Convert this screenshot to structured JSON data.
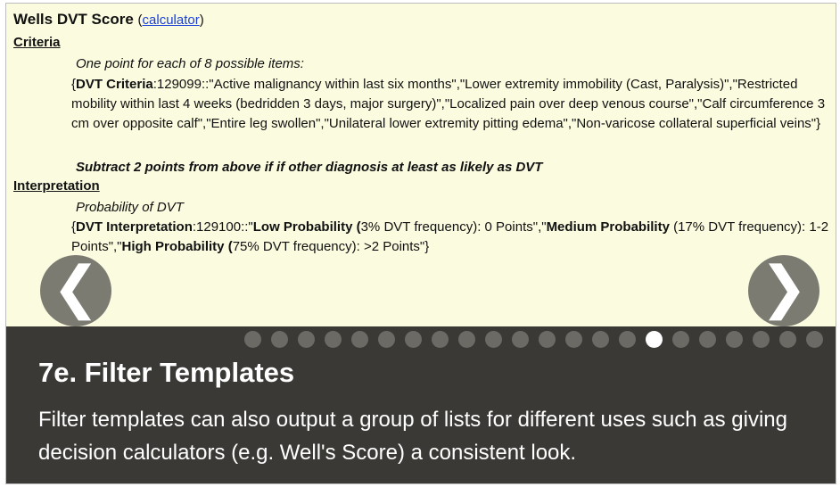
{
  "doc": {
    "title": "Wells DVT Score",
    "calculator_link_open": "(",
    "calculator_link": "calculator",
    "calculator_link_close": ")",
    "criteria_heading": "Criteria",
    "criteria_intro": "One point for each of 8 possible items:",
    "criteria_list": [
      {
        "text": "{",
        "bold": false
      },
      {
        "text": "DVT Criteria",
        "bold": true
      },
      {
        "text": ":129099::\"Active malignancy within last six months\",\"Lower extremity immobility (Cast, Paralysis)\",\"Restricted mobility within last 4 weeks (bedridden 3 days, major surgery)\",\"Localized pain over deep venous course\",\"Calf circumference 3 cm over opposite calf\",\"Entire leg swollen\",\"Unilateral lower extremity pitting edema\",\"Non-varicose collateral superficial veins\"}",
        "bold": false
      }
    ],
    "subtract_note": "Subtract 2 points from above if if other diagnosis at least as likely as DVT",
    "interpretation_heading": "Interpretation",
    "interpretation_intro": "Probability of DVT",
    "interpretation_list": [
      {
        "text": "{",
        "bold": false
      },
      {
        "text": "DVT Interpretation",
        "bold": true
      },
      {
        "text": ":129100::\"",
        "bold": false
      },
      {
        "text": "Low Probability (",
        "bold": true
      },
      {
        "text": "3% DVT frequency): 0 Points\",\"",
        "bold": false
      },
      {
        "text": "Medium Probability",
        "bold": true
      },
      {
        "text": " (17% DVT frequency): 1-2 Points\",\"",
        "bold": false
      },
      {
        "text": "High Probability (",
        "bold": true
      },
      {
        "text": "75% DVT frequency): >2 Points\"}",
        "bold": false
      }
    ]
  },
  "carousel": {
    "prev_arrow": "❮",
    "next_arrow": "❯",
    "slide_count": 22,
    "active_index": 15,
    "title": "7e. Filter Templates",
    "description": "Filter templates can also output a group of lists for different uses such as giving decision calculators (e.g. Well's Score) a consistent look."
  },
  "colors": {
    "doc_background": "#fbfbe0",
    "caption_background": "#3a3936",
    "arrow_background": "#7b7b72",
    "dot_inactive": "#6b6a65",
    "dot_active": "#ffffff",
    "link": "#1a3fd6"
  },
  "icons": {
    "prev": "chevron-left-icon",
    "next": "chevron-right-icon"
  }
}
